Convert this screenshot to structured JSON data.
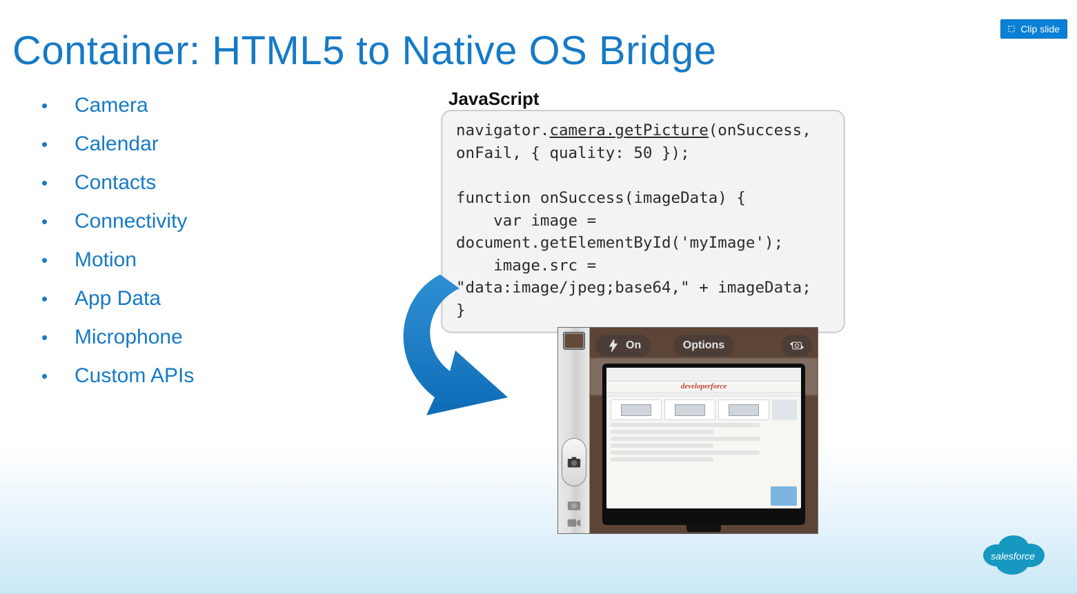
{
  "clip_button_label": "Clip slide",
  "title": "Container: HTML5 to Native OS Bridge",
  "bullets": [
    "Camera",
    "Calendar",
    "Contacts",
    "Connectivity",
    "Motion",
    "App Data",
    "Microphone",
    "Custom APIs"
  ],
  "code": {
    "label": "JavaScript",
    "line1_head": "navigator.",
    "line1_ul": "camera.getPicture",
    "line1_tail": "(onSuccess, onFail, { quality: 50 });",
    "block": "function onSuccess(imageData) {\n    var image = document.getElementById('myImage');\n    image.src = \"data:image/jpeg;base64,\" + imageData;\n}"
  },
  "camera_ui": {
    "flash_label": "On",
    "options_label": "Options",
    "site_header": "developerforce"
  },
  "logo_alt": "salesforce",
  "colors": {
    "accent": "#167ac6",
    "button": "#0a7fd6"
  }
}
